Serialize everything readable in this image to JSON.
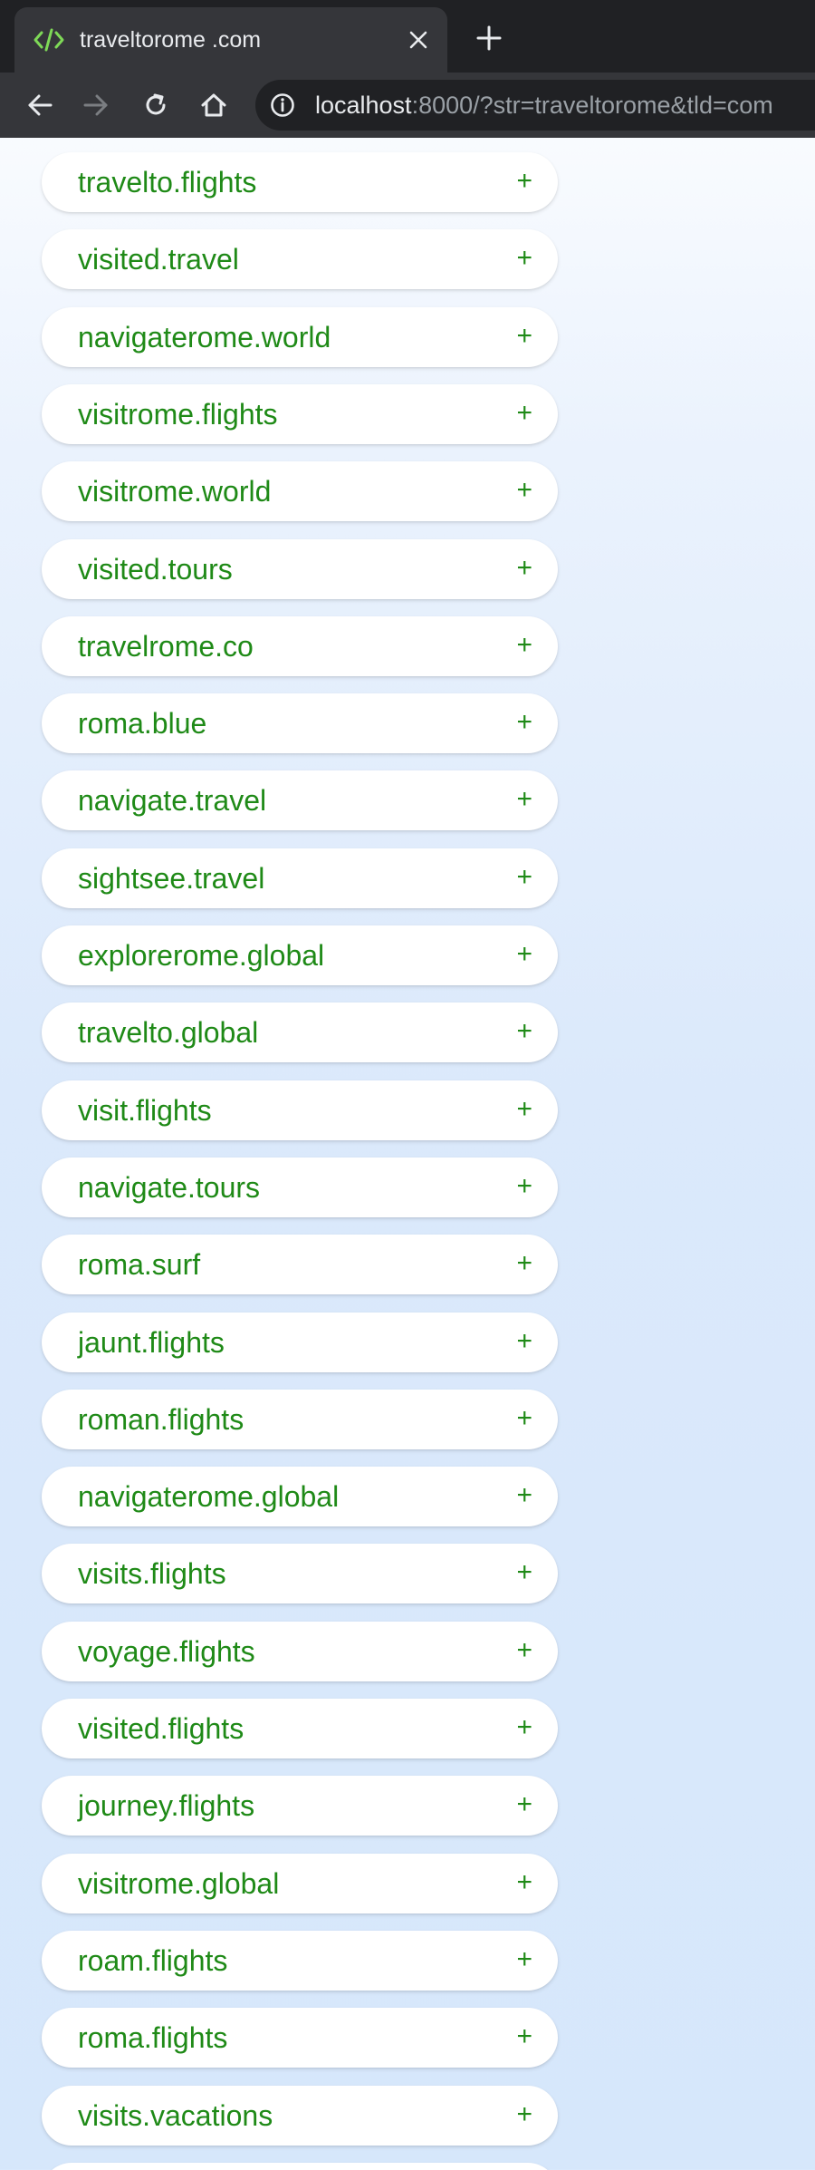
{
  "browser": {
    "tab_title": "traveltorome .com",
    "url_host": "localhost",
    "url_rest": ":8000/?str=traveltorome&tld=com",
    "new_tab_symbol": "+",
    "icons": {
      "favicon": "code-icon",
      "close": "close-icon",
      "new_tab": "plus-icon",
      "back": "back-arrow-icon",
      "forward": "forward-arrow-icon",
      "reload": "reload-icon",
      "home": "home-icon",
      "site_info": "info-icon"
    }
  },
  "colors": {
    "accent_green": "#1f8a17",
    "chrome_dark": "#202124",
    "chrome_tab": "#35363a"
  },
  "add_symbol": "+",
  "domains": [
    "travelto.flights",
    "visited.travel",
    "navigaterome.world",
    "visitrome.flights",
    "visitrome.world",
    "visited.tours",
    "travelrome.co",
    "roma.blue",
    "navigate.travel",
    "sightsee.travel",
    "explorerome.global",
    "travelto.global",
    "visit.flights",
    "navigate.tours",
    "roma.surf",
    "jaunt.flights",
    "roman.flights",
    "navigaterome.global",
    "visits.flights",
    "voyage.flights",
    "visited.flights",
    "journey.flights",
    "visitrome.global",
    "roam.flights",
    "roma.flights",
    "visits.vacations",
    ""
  ]
}
